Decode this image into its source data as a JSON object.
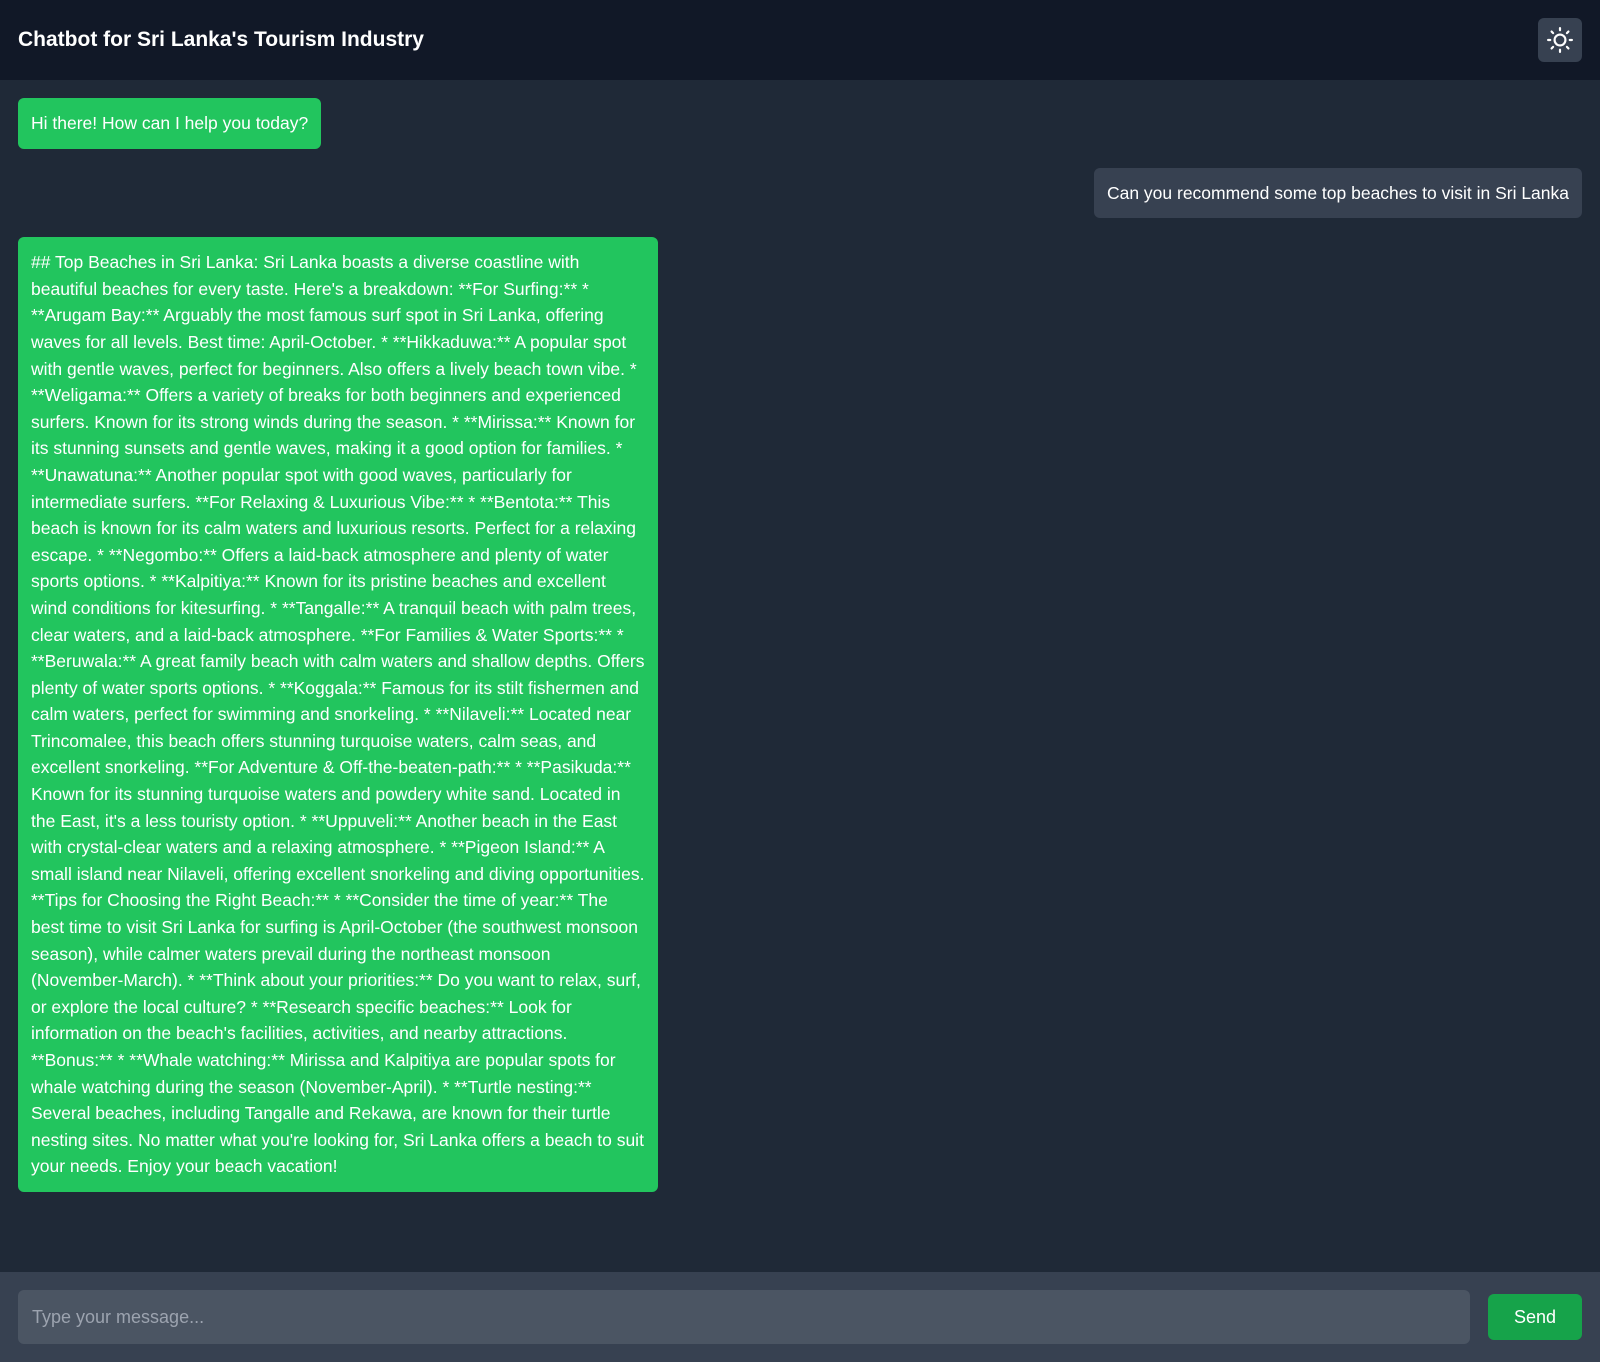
{
  "header": {
    "title": "Chatbot for Sri Lanka's Tourism Industry",
    "theme_toggle_icon": "sun-icon"
  },
  "messages": [
    {
      "role": "bot",
      "text": "Hi there! How can I help you today?"
    },
    {
      "role": "user",
      "text": "Can you recommend some top beaches to visit in Sri Lanka"
    },
    {
      "role": "bot",
      "text": "## Top Beaches in Sri Lanka: Sri Lanka boasts a diverse coastline with beautiful beaches for every taste. Here's a breakdown: **For Surfing:** * **Arugam Bay:** Arguably the most famous surf spot in Sri Lanka, offering waves for all levels. Best time: April-October. * **Hikkaduwa:** A popular spot with gentle waves, perfect for beginners. Also offers a lively beach town vibe. * **Weligama:** Offers a variety of breaks for both beginners and experienced surfers. Known for its strong winds during the season. * **Mirissa:** Known for its stunning sunsets and gentle waves, making it a good option for families. * **Unawatuna:** Another popular spot with good waves, particularly for intermediate surfers. **For Relaxing & Luxurious Vibe:** * **Bentota:** This beach is known for its calm waters and luxurious resorts. Perfect for a relaxing escape. * **Negombo:** Offers a laid-back atmosphere and plenty of water sports options. * **Kalpitiya:** Known for its pristine beaches and excellent wind conditions for kitesurfing. * **Tangalle:** A tranquil beach with palm trees, clear waters, and a laid-back atmosphere. **For Families & Water Sports:** * **Beruwala:** A great family beach with calm waters and shallow depths. Offers plenty of water sports options. * **Koggala:** Famous for its stilt fishermen and calm waters, perfect for swimming and snorkeling. * **Nilaveli:** Located near Trincomalee, this beach offers stunning turquoise waters, calm seas, and excellent snorkeling. **For Adventure & Off-the-beaten-path:** * **Pasikuda:** Known for its stunning turquoise waters and powdery white sand. Located in the East, it's a less touristy option. * **Uppuveli:** Another beach in the East with crystal-clear waters and a relaxing atmosphere. * **Pigeon Island:** A small island near Nilaveli, offering excellent snorkeling and diving opportunities. **Tips for Choosing the Right Beach:** * **Consider the time of year:** The best time to visit Sri Lanka for surfing is April-October (the southwest monsoon season), while calmer waters prevail during the northeast monsoon (November-March). * **Think about your priorities:** Do you want to relax, surf, or explore the local culture? * **Research specific beaches:** Look for information on the beach's facilities, activities, and nearby attractions. **Bonus:** * **Whale watching:** Mirissa and Kalpitiya are popular spots for whale watching during the season (November-April). * **Turtle nesting:** Several beaches, including Tangalle and Rekawa, are known for their turtle nesting sites. No matter what you're looking for, Sri Lanka offers a beach to suit your needs. Enjoy your beach vacation!"
    }
  ],
  "composer": {
    "placeholder": "Type your message...",
    "value": "",
    "send_label": "Send"
  },
  "colors": {
    "header_bg": "#111827",
    "chat_bg": "#1f2937",
    "bot_bubble": "#22c55e",
    "user_bubble": "#374151",
    "footer_bg": "#374151",
    "input_bg": "#4b5563",
    "send_button": "#16a34a"
  }
}
